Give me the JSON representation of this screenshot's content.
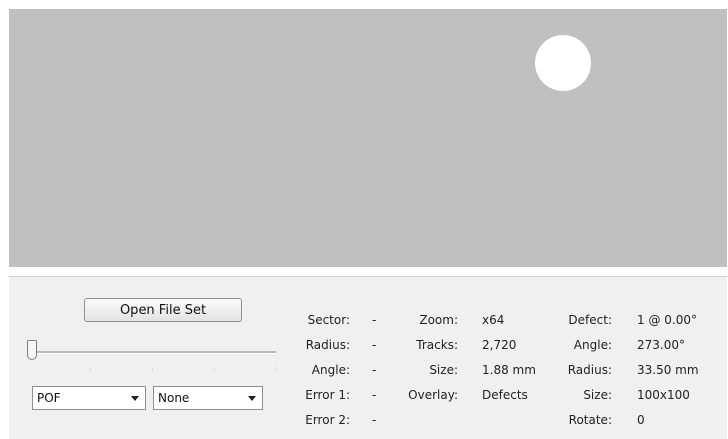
{
  "viewport": {
    "background": "#c0c0c0",
    "marker_color": "#ffffff"
  },
  "controls": {
    "open_button": "Open File Set",
    "select_1": "POF",
    "select_2": "None"
  },
  "info": {
    "col1": [
      {
        "label": "Sector:",
        "value": "-"
      },
      {
        "label": "Radius:",
        "value": "-"
      },
      {
        "label": "Angle:",
        "value": "-"
      },
      {
        "label": "Error 1:",
        "value": "-"
      },
      {
        "label": "Error 2:",
        "value": "-"
      }
    ],
    "col2": [
      {
        "label": "Zoom:",
        "value": "x64"
      },
      {
        "label": "Tracks:",
        "value": "2,720"
      },
      {
        "label": "Size:",
        "value": "1.88 mm"
      },
      {
        "label": "Overlay:",
        "value": "Defects"
      }
    ],
    "col3": [
      {
        "label": "Defect:",
        "value": "1 @ 0.00°"
      },
      {
        "label": "Angle:",
        "value": "273.00°"
      },
      {
        "label": "Radius:",
        "value": "33.50 mm"
      },
      {
        "label": "Size:",
        "value": "100x100"
      },
      {
        "label": "Rotate:",
        "value": "0"
      }
    ]
  }
}
